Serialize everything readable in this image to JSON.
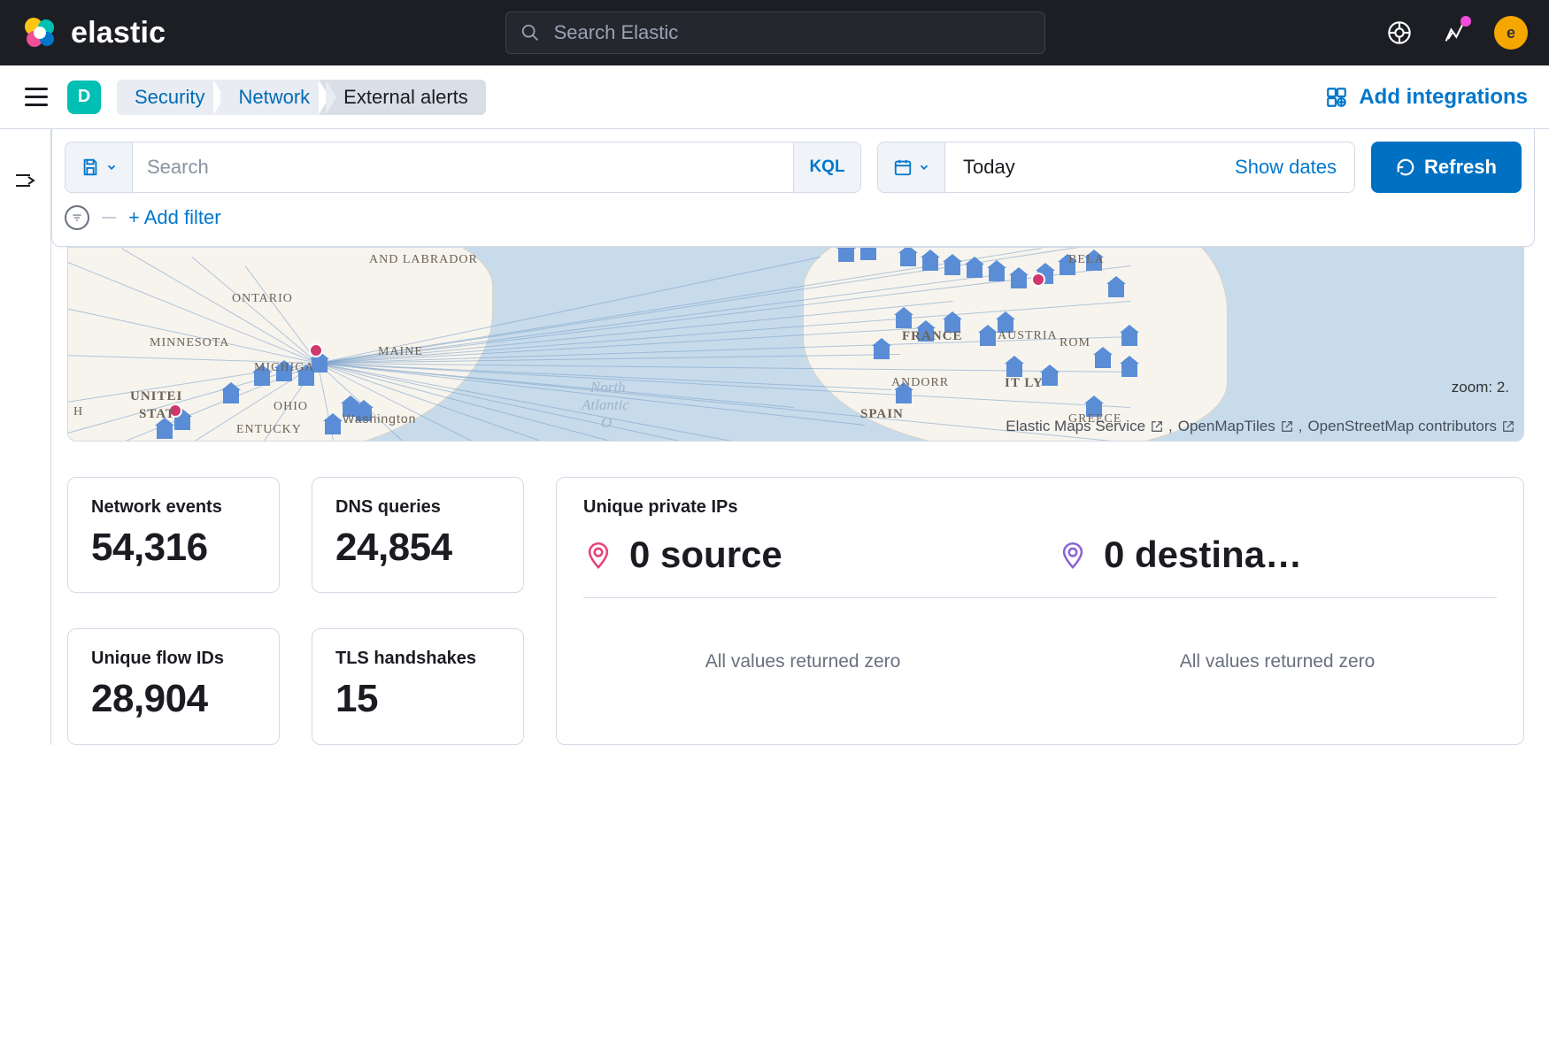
{
  "header": {
    "brand": "elastic",
    "search_placeholder": "Search Elastic",
    "avatar_letter": "e"
  },
  "secondbar": {
    "space_letter": "D",
    "breadcrumbs": [
      "Security",
      "Network",
      "External alerts"
    ],
    "add_integrations": "Add integrations"
  },
  "query": {
    "search_placeholder": "Search",
    "kql_label": "KQL",
    "date_label": "Today",
    "show_dates": "Show dates",
    "refresh": "Refresh",
    "add_filter": "+ Add filter"
  },
  "map": {
    "labels": {
      "and_labrador": "AND LABRADOR",
      "ontario": "ONTARIO",
      "minnesota": "MINNESOTA",
      "maine": "MAINE",
      "michiga": "MICHIGA",
      "ohio": "OHIO",
      "kentucky": "ENTUCKY",
      "united_states_1": "UNITEI",
      "united_states_2": "STAT",
      "washington": "Washington",
      "france": "FRANCE",
      "austria": "AUSTRIA",
      "andorr": "ANDORR",
      "italy": "IT  LY",
      "spain": "SPAIN",
      "greece": "GREECE",
      "bela": "BELA",
      "rom": "ROM\u0000",
      "h": "H",
      "ocean1": "North",
      "ocean2": "Atlantic",
      "ocean3": "O"
    },
    "zoom": "zoom: 2.",
    "attrib": {
      "ems": "Elastic Maps Service",
      "omt": "OpenMapTiles",
      "osm": "OpenStreetMap contributors"
    }
  },
  "stats": {
    "network_events": {
      "label": "Network events",
      "value": "54,316"
    },
    "dns_queries": {
      "label": "DNS queries",
      "value": "24,854"
    },
    "unique_flow_ids": {
      "label": "Unique flow IDs",
      "value": "28,904"
    },
    "tls_handshakes": {
      "label": "TLS handshakes",
      "value": "15"
    },
    "unique_private_ips": {
      "label": "Unique private IPs",
      "source": "0 source",
      "destination": "0 destina…",
      "zero_msg": "All values returned zero"
    }
  }
}
